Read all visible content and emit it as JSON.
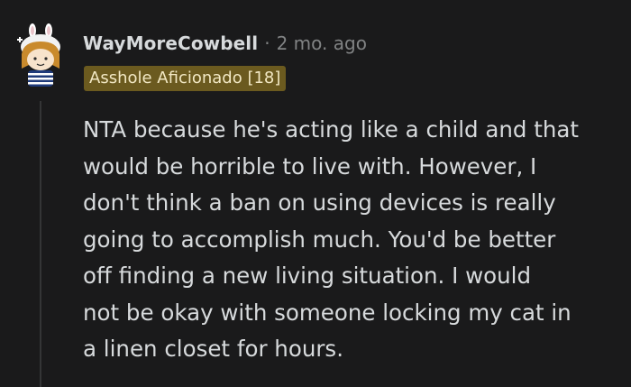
{
  "comment": {
    "author": "WayMoreCowbell",
    "separator": "·",
    "age": "2 mo. ago",
    "flair": "Asshole Aficionado [18]",
    "body_lines": [
      "NTA because he's acting like a child and that",
      "would be horrible to live with. However, I",
      "don't think a ban on using devices is really",
      "going to accomplish much. You'd be better",
      "off finding a new living situation. I would",
      "not be okay with someone locking my cat in",
      "a linen closet for hours."
    ]
  },
  "colors": {
    "background": "#1a1a1b",
    "text": "#d7dadc",
    "meta": "#818384",
    "flair_bg": "#6b5a1f",
    "flair_text": "#f2e8c4",
    "thread_line": "#343536"
  },
  "icons": {
    "avatar": "bunny-ears-avatar-icon"
  }
}
